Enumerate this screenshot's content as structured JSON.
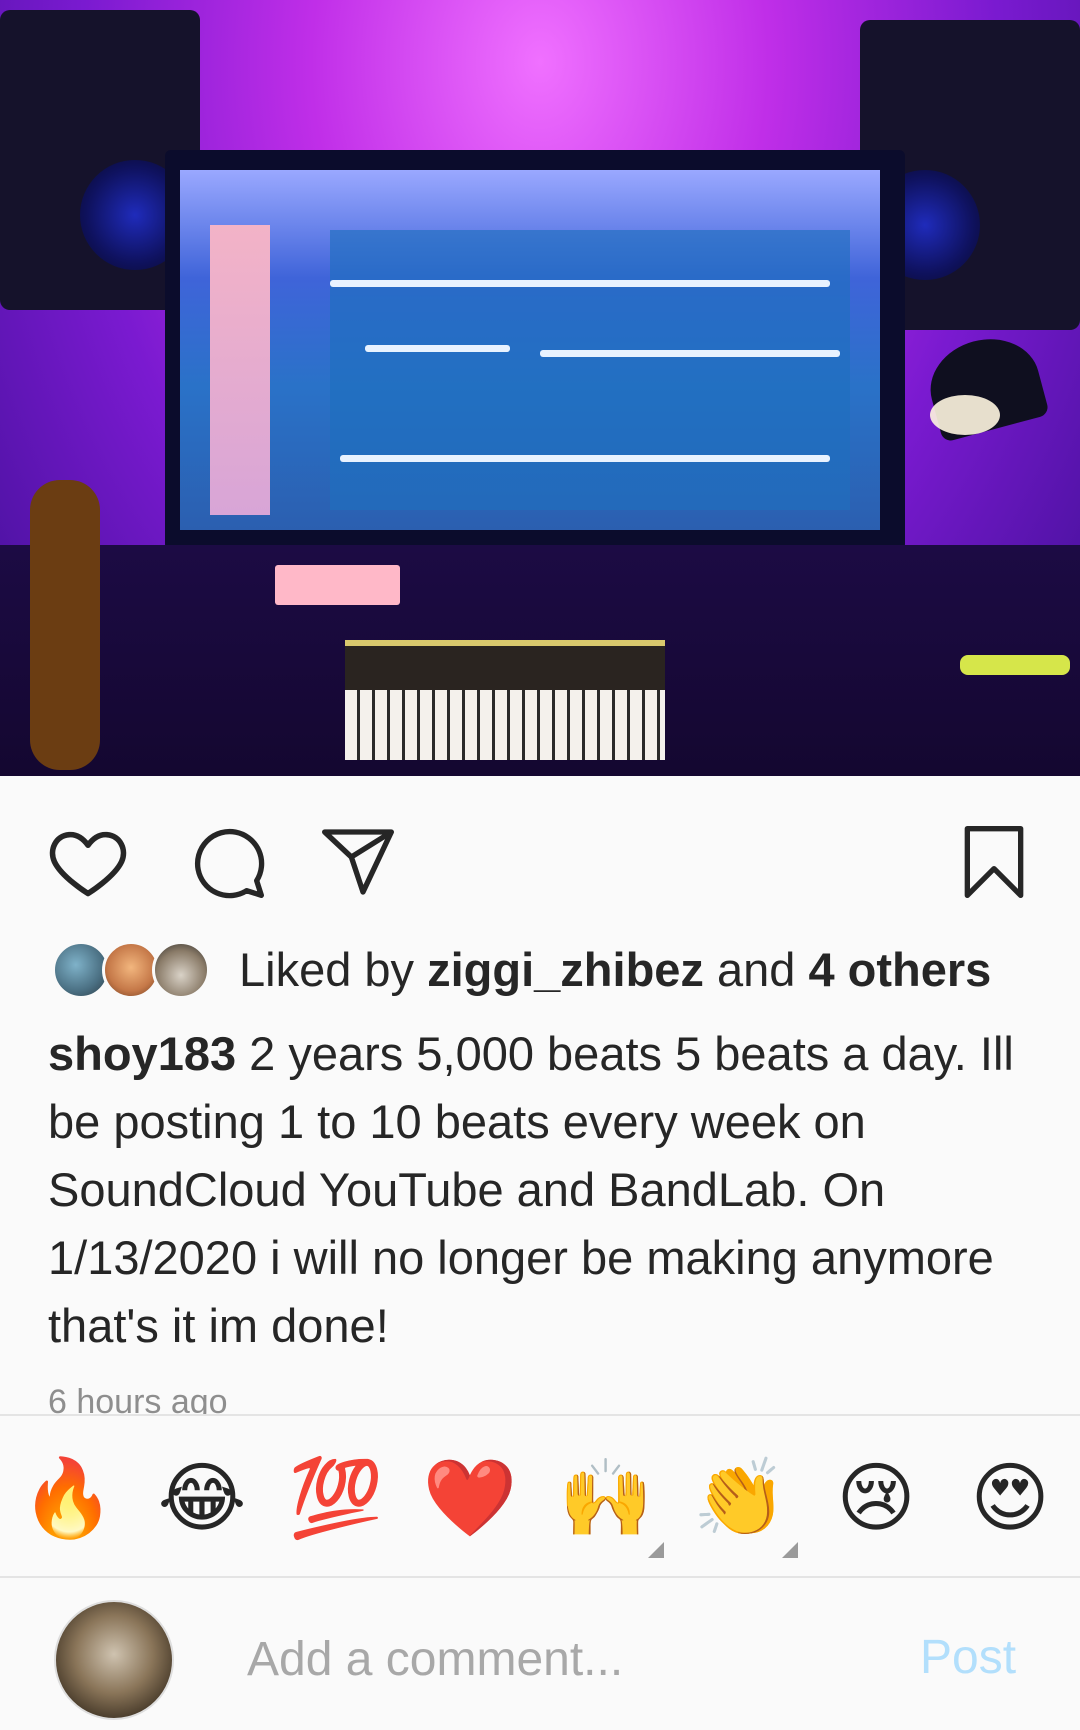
{
  "post": {
    "image_alt": "",
    "actions": {
      "like_icon": "heart-outline-icon",
      "comment_icon": "comment-bubble-icon",
      "share_icon": "paper-plane-icon",
      "save_icon": "bookmark-icon"
    },
    "likes": {
      "prefix": "Liked by ",
      "user": "ziggi_zhibez",
      "middle": " and ",
      "others": "4 others"
    },
    "caption": {
      "username": "shoy183",
      "text": " 2 years 5,000 beats 5 beats a day. Ill be posting 1 to 10 beats every week on SoundCloud YouTube and BandLab. On 1/13/2020 i will no longer be making anymore that's it im done!"
    },
    "timestamp": "6 hours ago"
  },
  "reactions": [
    {
      "emoji": "🔥",
      "name": "fire"
    },
    {
      "emoji": "😂",
      "name": "tears-of-joy"
    },
    {
      "emoji": "💯",
      "name": "hundred-points"
    },
    {
      "emoji": "❤️",
      "name": "red-heart"
    },
    {
      "emoji": "🙌",
      "name": "raising-hands"
    },
    {
      "emoji": "👏",
      "name": "clapping-hands"
    },
    {
      "emoji": "😢",
      "name": "crying-face"
    },
    {
      "emoji": "😍",
      "name": "heart-eyes"
    }
  ],
  "comment_bar": {
    "placeholder": "Add a comment...",
    "post_label": "Post"
  },
  "colors": {
    "post_link": "#b2dffc",
    "text": "#262626",
    "secondary": "#8e8e8e"
  }
}
